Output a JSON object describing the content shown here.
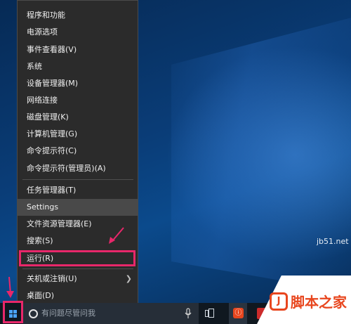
{
  "menu": {
    "items": [
      {
        "label": "程序和功能"
      },
      {
        "label": "电源选项"
      },
      {
        "label": "事件查看器(V)"
      },
      {
        "label": "系统"
      },
      {
        "label": "设备管理器(M)"
      },
      {
        "label": "网络连接"
      },
      {
        "label": "磁盘管理(K)"
      },
      {
        "label": "计算机管理(G)"
      },
      {
        "label": "命令提示符(C)"
      },
      {
        "label": "命令提示符(管理员)(A)"
      },
      {
        "label": "任务管理器(T)"
      },
      {
        "label": "Settings",
        "highlighted": true
      },
      {
        "label": "文件资源管理器(E)"
      },
      {
        "label": "搜索(S)"
      },
      {
        "label": "运行(R)"
      },
      {
        "label": "关机或注销(U)",
        "has_submenu": true
      },
      {
        "label": "桌面(D)"
      }
    ]
  },
  "taskbar": {
    "search_placeholder": "有问题尽管问我",
    "icons": [
      "windows-logo-icon",
      "cortana-icon",
      "microphone-icon",
      "task-view-icon",
      "app-icon",
      "app-icon-red"
    ]
  },
  "watermark": {
    "site": "jb51.net",
    "logo_glyph": "J",
    "text": "脚本之家"
  },
  "colors": {
    "highlight_border": "#e8276a",
    "menu_bg": "#2b2b2b",
    "menu_hover": "#494949",
    "taskbar_bg": "#101820",
    "watermark_red": "#e8461e"
  }
}
